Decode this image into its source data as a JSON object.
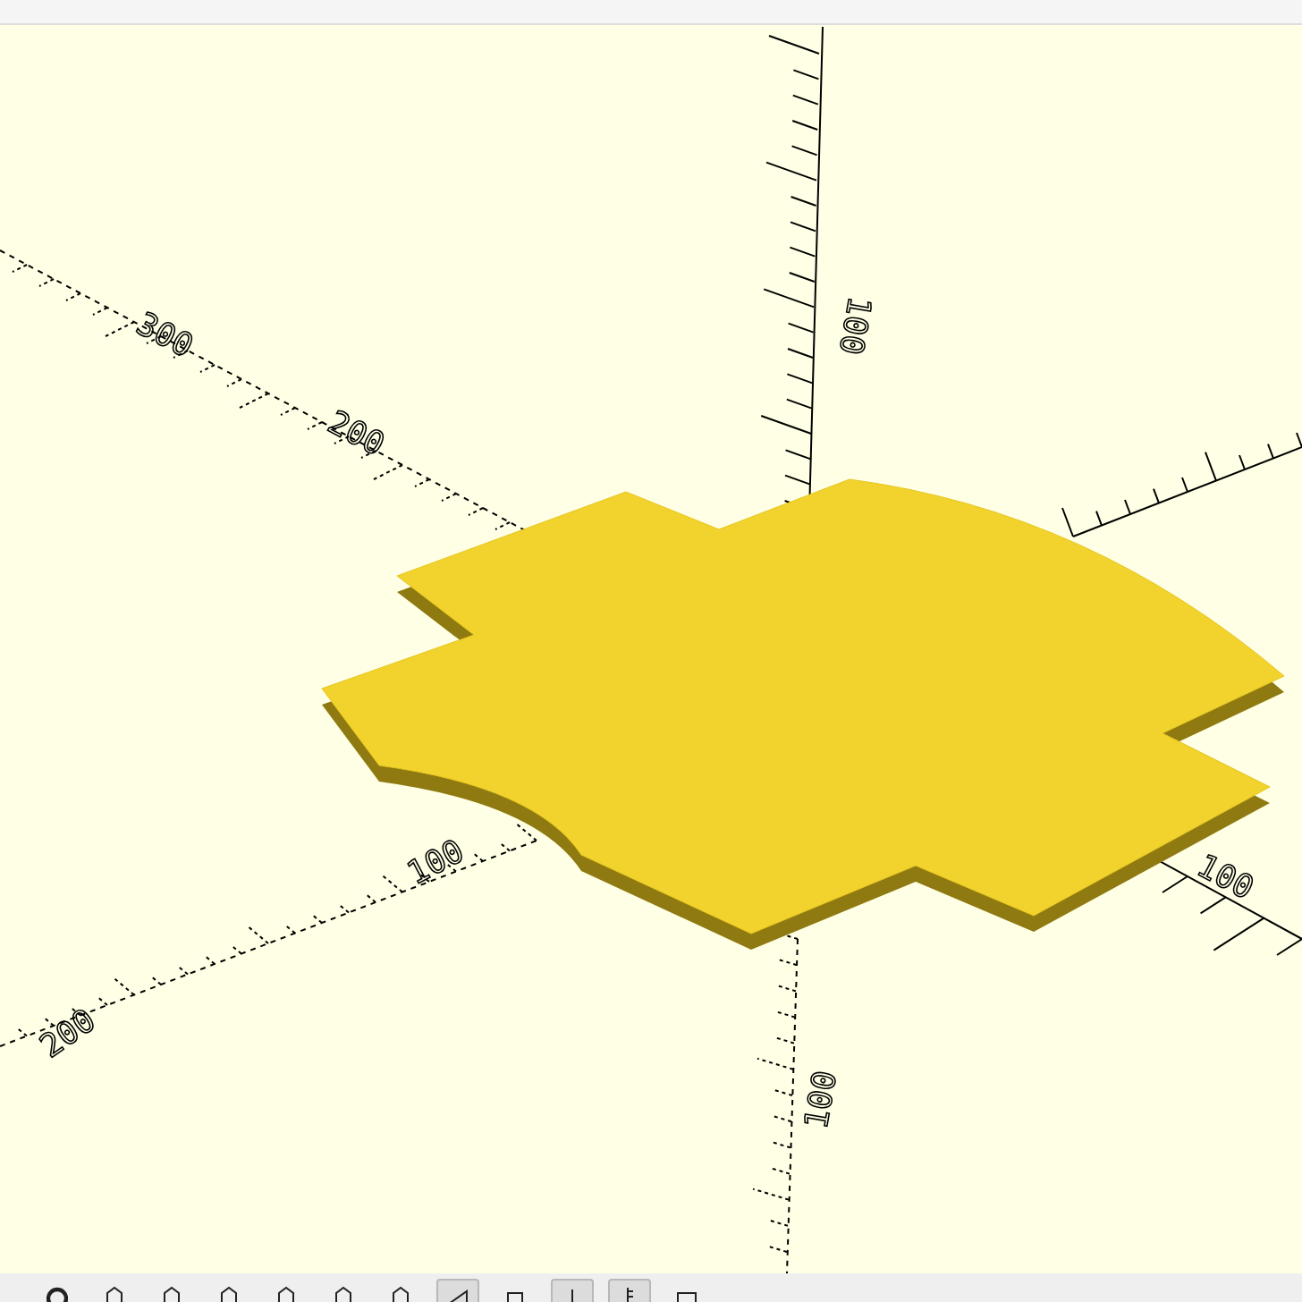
{
  "viewport": {
    "axis_labels": [
      {
        "text": "300"
      },
      {
        "text": "200"
      },
      {
        "text": "100"
      },
      {
        "text": "100"
      },
      {
        "text": "200"
      },
      {
        "text": "100"
      },
      {
        "text": "100"
      }
    ]
  },
  "toolbar": {
    "buttons": [
      {
        "kind": "reset",
        "selected": false
      },
      {
        "kind": "view",
        "selected": false
      },
      {
        "kind": "view",
        "selected": false
      },
      {
        "kind": "view",
        "selected": false
      },
      {
        "kind": "view",
        "selected": false
      },
      {
        "kind": "view",
        "selected": false
      },
      {
        "kind": "view",
        "selected": false
      },
      {
        "kind": "perspective",
        "selected": true
      },
      {
        "kind": "orthogonal",
        "selected": false
      },
      {
        "kind": "axes",
        "selected": true
      },
      {
        "kind": "scale",
        "selected": true
      },
      {
        "kind": "edges",
        "selected": false
      }
    ]
  }
}
